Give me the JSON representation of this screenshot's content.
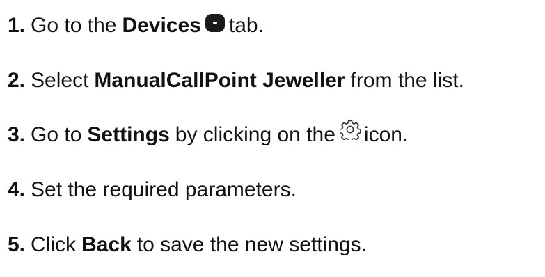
{
  "steps": [
    {
      "number": "1.",
      "parts": [
        "Go to the",
        "Devices",
        "tab."
      ],
      "icon": "devices-tab-icon"
    },
    {
      "number": "2.",
      "parts": [
        "Select",
        "ManualCallPoint Jeweller",
        "from the list."
      ]
    },
    {
      "number": "3.",
      "parts": [
        "Go to",
        "Settings",
        "by clicking on the",
        "icon."
      ],
      "icon": "gear-icon"
    },
    {
      "number": "4.",
      "parts": [
        "Set the required parameters."
      ]
    },
    {
      "number": "5.",
      "parts": [
        "Click",
        "Back",
        "to save the new settings."
      ]
    }
  ]
}
